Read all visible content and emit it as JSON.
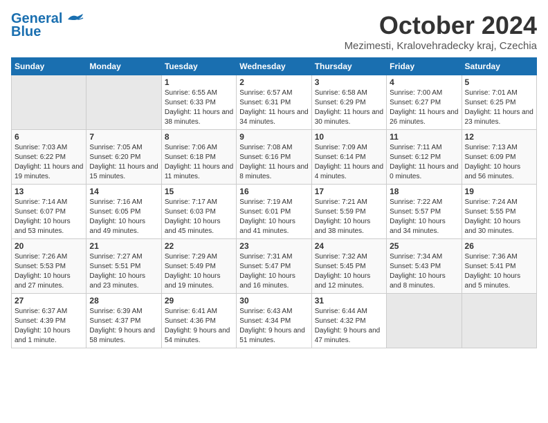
{
  "logo": {
    "line1": "General",
    "line2": "Blue"
  },
  "title": "October 2024",
  "subtitle": "Mezimesti, Kralovehradecky kraj, Czechia",
  "days_of_week": [
    "Sunday",
    "Monday",
    "Tuesday",
    "Wednesday",
    "Thursday",
    "Friday",
    "Saturday"
  ],
  "weeks": [
    [
      {
        "num": "",
        "info": ""
      },
      {
        "num": "",
        "info": ""
      },
      {
        "num": "1",
        "info": "Sunrise: 6:55 AM\nSunset: 6:33 PM\nDaylight: 11 hours and 38 minutes."
      },
      {
        "num": "2",
        "info": "Sunrise: 6:57 AM\nSunset: 6:31 PM\nDaylight: 11 hours and 34 minutes."
      },
      {
        "num": "3",
        "info": "Sunrise: 6:58 AM\nSunset: 6:29 PM\nDaylight: 11 hours and 30 minutes."
      },
      {
        "num": "4",
        "info": "Sunrise: 7:00 AM\nSunset: 6:27 PM\nDaylight: 11 hours and 26 minutes."
      },
      {
        "num": "5",
        "info": "Sunrise: 7:01 AM\nSunset: 6:25 PM\nDaylight: 11 hours and 23 minutes."
      }
    ],
    [
      {
        "num": "6",
        "info": "Sunrise: 7:03 AM\nSunset: 6:22 PM\nDaylight: 11 hours and 19 minutes."
      },
      {
        "num": "7",
        "info": "Sunrise: 7:05 AM\nSunset: 6:20 PM\nDaylight: 11 hours and 15 minutes."
      },
      {
        "num": "8",
        "info": "Sunrise: 7:06 AM\nSunset: 6:18 PM\nDaylight: 11 hours and 11 minutes."
      },
      {
        "num": "9",
        "info": "Sunrise: 7:08 AM\nSunset: 6:16 PM\nDaylight: 11 hours and 8 minutes."
      },
      {
        "num": "10",
        "info": "Sunrise: 7:09 AM\nSunset: 6:14 PM\nDaylight: 11 hours and 4 minutes."
      },
      {
        "num": "11",
        "info": "Sunrise: 7:11 AM\nSunset: 6:12 PM\nDaylight: 11 hours and 0 minutes."
      },
      {
        "num": "12",
        "info": "Sunrise: 7:13 AM\nSunset: 6:09 PM\nDaylight: 10 hours and 56 minutes."
      }
    ],
    [
      {
        "num": "13",
        "info": "Sunrise: 7:14 AM\nSunset: 6:07 PM\nDaylight: 10 hours and 53 minutes."
      },
      {
        "num": "14",
        "info": "Sunrise: 7:16 AM\nSunset: 6:05 PM\nDaylight: 10 hours and 49 minutes."
      },
      {
        "num": "15",
        "info": "Sunrise: 7:17 AM\nSunset: 6:03 PM\nDaylight: 10 hours and 45 minutes."
      },
      {
        "num": "16",
        "info": "Sunrise: 7:19 AM\nSunset: 6:01 PM\nDaylight: 10 hours and 41 minutes."
      },
      {
        "num": "17",
        "info": "Sunrise: 7:21 AM\nSunset: 5:59 PM\nDaylight: 10 hours and 38 minutes."
      },
      {
        "num": "18",
        "info": "Sunrise: 7:22 AM\nSunset: 5:57 PM\nDaylight: 10 hours and 34 minutes."
      },
      {
        "num": "19",
        "info": "Sunrise: 7:24 AM\nSunset: 5:55 PM\nDaylight: 10 hours and 30 minutes."
      }
    ],
    [
      {
        "num": "20",
        "info": "Sunrise: 7:26 AM\nSunset: 5:53 PM\nDaylight: 10 hours and 27 minutes."
      },
      {
        "num": "21",
        "info": "Sunrise: 7:27 AM\nSunset: 5:51 PM\nDaylight: 10 hours and 23 minutes."
      },
      {
        "num": "22",
        "info": "Sunrise: 7:29 AM\nSunset: 5:49 PM\nDaylight: 10 hours and 19 minutes."
      },
      {
        "num": "23",
        "info": "Sunrise: 7:31 AM\nSunset: 5:47 PM\nDaylight: 10 hours and 16 minutes."
      },
      {
        "num": "24",
        "info": "Sunrise: 7:32 AM\nSunset: 5:45 PM\nDaylight: 10 hours and 12 minutes."
      },
      {
        "num": "25",
        "info": "Sunrise: 7:34 AM\nSunset: 5:43 PM\nDaylight: 10 hours and 8 minutes."
      },
      {
        "num": "26",
        "info": "Sunrise: 7:36 AM\nSunset: 5:41 PM\nDaylight: 10 hours and 5 minutes."
      }
    ],
    [
      {
        "num": "27",
        "info": "Sunrise: 6:37 AM\nSunset: 4:39 PM\nDaylight: 10 hours and 1 minute."
      },
      {
        "num": "28",
        "info": "Sunrise: 6:39 AM\nSunset: 4:37 PM\nDaylight: 9 hours and 58 minutes."
      },
      {
        "num": "29",
        "info": "Sunrise: 6:41 AM\nSunset: 4:36 PM\nDaylight: 9 hours and 54 minutes."
      },
      {
        "num": "30",
        "info": "Sunrise: 6:43 AM\nSunset: 4:34 PM\nDaylight: 9 hours and 51 minutes."
      },
      {
        "num": "31",
        "info": "Sunrise: 6:44 AM\nSunset: 4:32 PM\nDaylight: 9 hours and 47 minutes."
      },
      {
        "num": "",
        "info": ""
      },
      {
        "num": "",
        "info": ""
      }
    ]
  ]
}
